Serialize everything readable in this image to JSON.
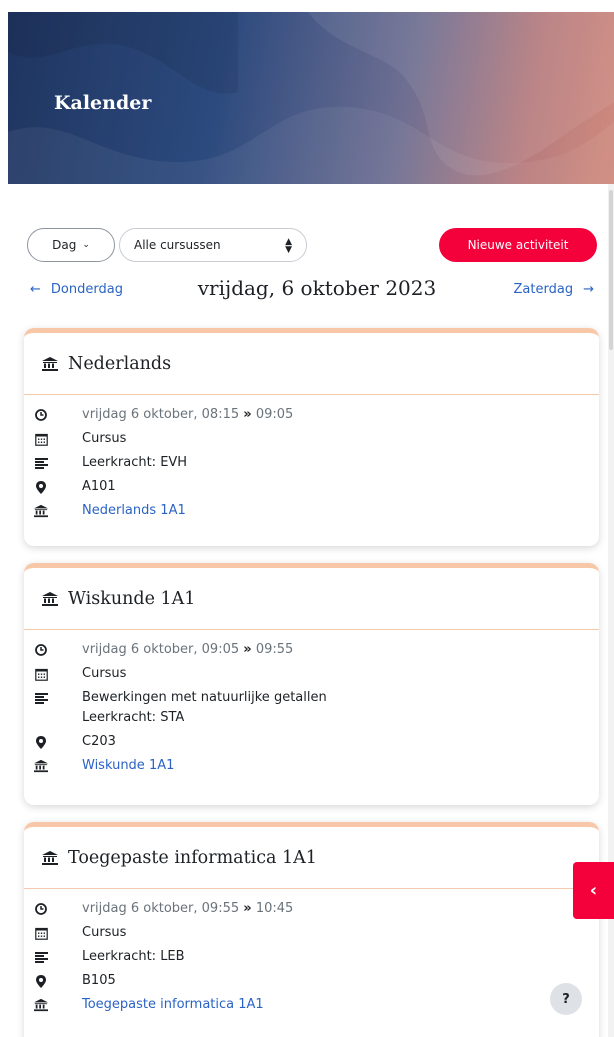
{
  "header": {
    "title": "Kalender"
  },
  "toolbar": {
    "view_label": "Dag",
    "course_filter_value": "Alle cursussen",
    "new_event_label": "Nieuwe activiteit"
  },
  "daynav": {
    "prev_label": "Donderdag",
    "day_title": "vrijdag, 6 oktober 2023",
    "next_label": "Zaterdag"
  },
  "events": [
    {
      "title": "Nederlands",
      "time_start": "vrijdag 6 oktober, 08:15",
      "time_sep": "»",
      "time_end": "09:05",
      "type": "Cursus",
      "desc1": "Leerkracht: EVH",
      "desc2": "",
      "location": "A101",
      "course_link": "Nederlands 1A1"
    },
    {
      "title": "Wiskunde 1A1",
      "time_start": "vrijdag 6 oktober, 09:05",
      "time_sep": "»",
      "time_end": "09:55",
      "type": "Cursus",
      "desc1": "Bewerkingen met natuurlijke getallen",
      "desc2": "Leerkracht: STA",
      "location": "C203",
      "course_link": "Wiskunde 1A1"
    },
    {
      "title": "Toegepaste informatica 1A1",
      "time_start": "vrijdag 6 oktober, 09:55",
      "time_sep": "»",
      "time_end": "10:45",
      "type": "Cursus",
      "desc1": "Leerkracht: LEB",
      "desc2": "",
      "location": "B105",
      "course_link": "Toegepaste informatica 1A1"
    }
  ],
  "help": {
    "label": "?"
  },
  "colors": {
    "accent": "#f4003a",
    "link": "#2a63c5",
    "card_border": "#f7c7a8"
  }
}
